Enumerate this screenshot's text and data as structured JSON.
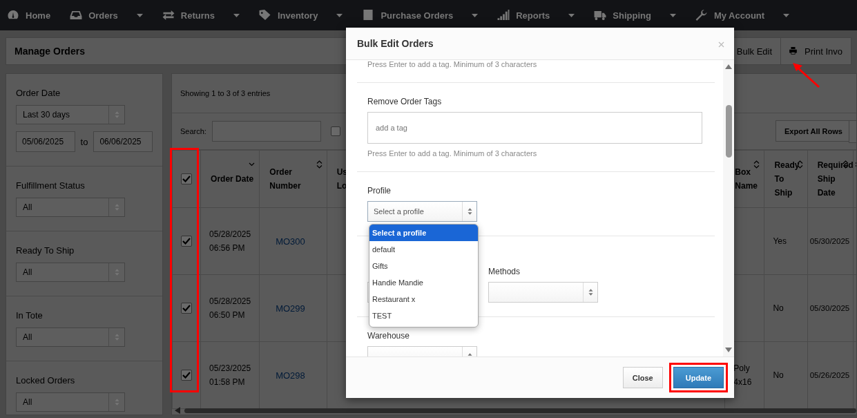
{
  "nav": [
    {
      "label": "Home",
      "has_menu": false
    },
    {
      "label": "Orders",
      "has_menu": true
    },
    {
      "label": "Returns",
      "has_menu": true
    },
    {
      "label": "Inventory",
      "has_menu": true
    },
    {
      "label": "Purchase Orders",
      "has_menu": true
    },
    {
      "label": "Reports",
      "has_menu": true
    },
    {
      "label": "Shipping",
      "has_menu": true
    },
    {
      "label": "My Account",
      "has_menu": true
    }
  ],
  "page_header": {
    "title": "Manage Orders",
    "actions": [
      {
        "label": "Bulk Edit"
      },
      {
        "label": "Print Invo"
      }
    ]
  },
  "filters": [
    {
      "kind": "date",
      "label": "Order Date",
      "value": "Last 30 days",
      "from": "05/06/2025",
      "separator": "to",
      "to": "06/06/2025"
    },
    {
      "kind": "select",
      "label": "Fulfillment Status",
      "value": "All"
    },
    {
      "kind": "select",
      "label": "Ready To Ship",
      "value": "All"
    },
    {
      "kind": "select",
      "label": "In Tote",
      "value": "All"
    },
    {
      "kind": "select",
      "label": "Locked Orders",
      "value": "All"
    }
  ],
  "table": {
    "info": "Showing 1 to 3 of 3 entries",
    "search_label": "Search:",
    "option": {
      "checked": false
    },
    "export_button": "Export All Rows",
    "header_checked": true,
    "columns": [
      {
        "label": "Order Date",
        "sorted": true
      },
      {
        "label": "Order Number",
        "sorted": false
      },
      {
        "label": "Us Lo"
      },
      {
        "label": "Box Name",
        "sorted": false
      },
      {
        "label": "Ready To Ship",
        "sorted": false
      },
      {
        "label": "Required Ship Date",
        "sorted": false
      },
      {
        "sorted": false
      }
    ],
    "rows": [
      {
        "checked": true,
        "date": "05/28/2025 06:56 PM",
        "number": "MO300",
        "ready": "Yes",
        "ship": "05/30/2025"
      },
      {
        "checked": true,
        "date": "05/28/2025 06:50 PM",
        "number": "MO299",
        "ready": "No",
        "ship": "05/30/2025"
      },
      {
        "checked": true,
        "date": "05/23/2025 01:58 PM",
        "number": "MO298",
        "box": "Poly 4x16",
        "ready": "No",
        "ship": "05/26/2025"
      }
    ]
  },
  "modal": {
    "title": "Bulk Edit Orders",
    "sections": [
      {
        "kind": "help",
        "text": "Press Enter to add a tag. Minimum of 3 characters"
      },
      {
        "kind": "tags",
        "label": "Remove Order Tags",
        "placeholder": "add a tag",
        "help": "Press Enter to add a tag. Minimum of 3 characters"
      },
      {
        "kind": "select",
        "label": "Profile",
        "value": "Select a profile",
        "open": true
      },
      {
        "kind": "pair",
        "label": "Methods"
      },
      {
        "kind": "select",
        "label": "Warehouse",
        "open": false
      }
    ],
    "buttons": [
      {
        "label": "Close",
        "primary": false,
        "highlighted": false
      },
      {
        "label": "Update",
        "primary": true,
        "highlighted": true
      }
    ]
  },
  "dropdown": {
    "options": [
      {
        "label": "Select a profile",
        "selected": true
      },
      {
        "label": "default",
        "selected": false
      },
      {
        "label": "Gifts",
        "selected": false
      },
      {
        "label": "Handie Mandie",
        "selected": false
      },
      {
        "label": "Restaurant x",
        "selected": false
      },
      {
        "label": "TEST",
        "selected": false
      }
    ]
  },
  "annotations": {
    "checkbox_column_highlight": true,
    "bulk_edit_arrow": true
  }
}
